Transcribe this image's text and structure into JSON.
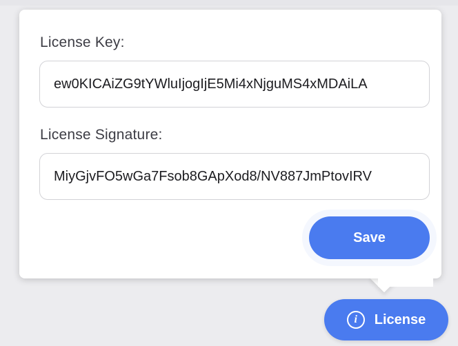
{
  "license_form": {
    "key_label": "License Key:",
    "key_value": "ew0KICAiZG9tYWluIjogIjE5Mi4xNjguMS4xMDAiLA",
    "signature_label": "License Signature:",
    "signature_value": "MiyGjvFO5wGa7Fsob8GApXod8/NV887JmPtovIRV",
    "save_label": "Save"
  },
  "license_button": {
    "label": "License",
    "icon": "info-icon",
    "icon_glyph": "i"
  },
  "colors": {
    "accent": "#4a7bef",
    "background": "#ececef",
    "panel": "#ffffff",
    "label_text": "#3c3c44",
    "input_border": "#d2d2d6"
  }
}
